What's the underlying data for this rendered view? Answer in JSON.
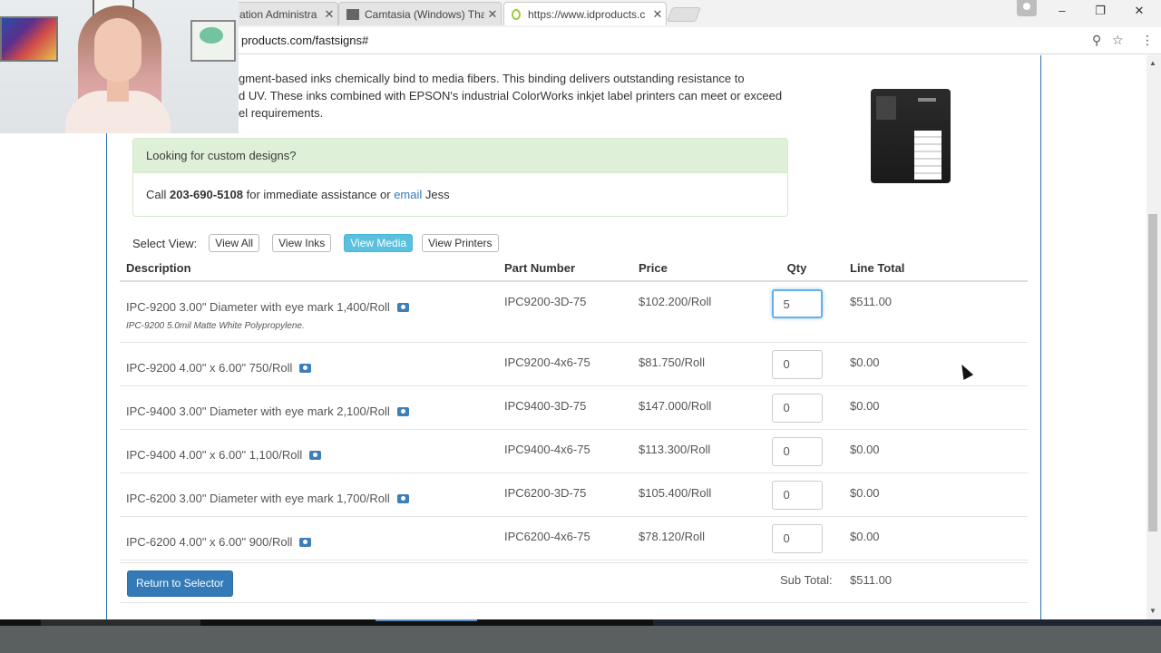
{
  "browser": {
    "tabs": [
      {
        "title": "ation Administra",
        "active": false
      },
      {
        "title": "Camtasia (Windows) Tha",
        "active": false
      },
      {
        "title": "https://www.idproducts.c",
        "active": true
      }
    ],
    "url_visible": "products.com/fastsigns#",
    "window_buttons": [
      "–",
      "❐",
      "✕"
    ]
  },
  "intro": {
    "line1": "gment-based inks chemically bind to media fibers. This binding delivers outstanding resistance to",
    "line2": "d UV. These inks combined with EPSON's industrial ColorWorks inkjet label printers can meet or exceed",
    "line3": "el requirements."
  },
  "callout": {
    "heading": "Looking for custom designs?",
    "call_prefix": "Call",
    "phone": "203-690-5108",
    "middle": "for immediate assistance or",
    "email_link": "email",
    "name": "Jess"
  },
  "select_view": {
    "label": "Select View:",
    "buttons": [
      {
        "label": "View All",
        "active": false
      },
      {
        "label": "View Inks",
        "active": false
      },
      {
        "label": "View Media",
        "active": true
      },
      {
        "label": "View Printers",
        "active": false
      }
    ]
  },
  "table": {
    "headers": {
      "description": "Description",
      "part": "Part Number",
      "price": "Price",
      "qty": "Qty",
      "total": "Line Total"
    },
    "rows": [
      {
        "description": "IPC-9200 3.00\" Diameter with eye mark 1,400/Roll",
        "subtext": "IPC-9200 5.0mil Matte White Polypropylene.",
        "part": "IPC9200-3D-75",
        "price": "$102.200/Roll",
        "qty": "5",
        "total": "$511.00"
      },
      {
        "description": "IPC-9200 4.00\" x 6.00\" 750/Roll",
        "part": "IPC9200-4x6-75",
        "price": "$81.750/Roll",
        "qty": "0",
        "total": "$0.00"
      },
      {
        "description": "IPC-9400 3.00\" Diameter with eye mark 2,100/Roll",
        "part": "IPC9400-3D-75",
        "price": "$147.000/Roll",
        "qty": "0",
        "total": "$0.00"
      },
      {
        "description": "IPC-9400 4.00\" x 6.00\" 1,100/Roll",
        "part": "IPC9400-4x6-75",
        "price": "$113.300/Roll",
        "qty": "0",
        "total": "$0.00"
      },
      {
        "description": "IPC-6200 3.00\" Diameter with eye mark 1,700/Roll",
        "part": "IPC6200-3D-75",
        "price": "$105.400/Roll",
        "qty": "0",
        "total": "$0.00"
      },
      {
        "description": "IPC-6200 4.00\" x 6.00\" 900/Roll",
        "part": "IPC6200-4x6-75",
        "price": "$78.120/Roll",
        "qty": "0",
        "total": "$0.00"
      }
    ]
  },
  "footer": {
    "return_button": "Return to Selector",
    "subtotal_label": "Sub Total:",
    "subtotal_value": "$511.00"
  },
  "colors": {
    "primary_button": "#337ab7",
    "active_view": "#5bc0de",
    "callout_header": "#dff0d8"
  }
}
